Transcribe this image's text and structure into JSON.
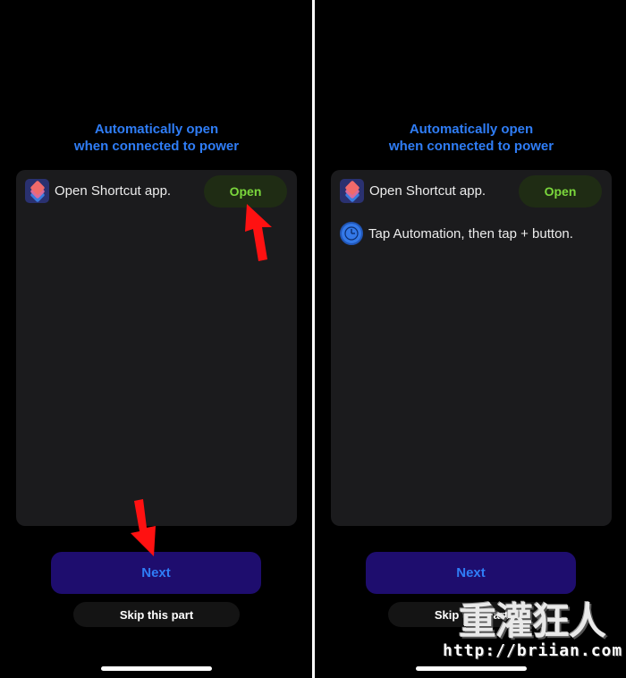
{
  "left_panel": {
    "title_line1": "Automatically open",
    "title_line2": "when connected to power",
    "steps": [
      {
        "icon": "shortcuts-app-icon",
        "text": "Open Shortcut app.",
        "action_label": "Open"
      }
    ],
    "next_label": "Next",
    "skip_label": "Skip this part"
  },
  "right_panel": {
    "title_line1": "Automatically open",
    "title_line2": "when connected to power",
    "steps": [
      {
        "icon": "shortcuts-app-icon",
        "text": "Open Shortcut app.",
        "action_label": "Open"
      },
      {
        "icon": "clock-icon",
        "text": "Tap Automation, then tap + button."
      }
    ],
    "next_label": "Next",
    "skip_label": "Skip this part"
  },
  "annotations": {
    "arrow_color": "#ff1111",
    "targets": [
      "open-button",
      "next-button"
    ]
  },
  "watermark": {
    "logo_text": "重灌狂人",
    "url": "http://briian.com"
  },
  "colors": {
    "accent_blue": "#2f7df6",
    "open_green": "#7bd73c",
    "next_bg": "#1e0d6e",
    "card_bg": "#1b1b1d"
  }
}
